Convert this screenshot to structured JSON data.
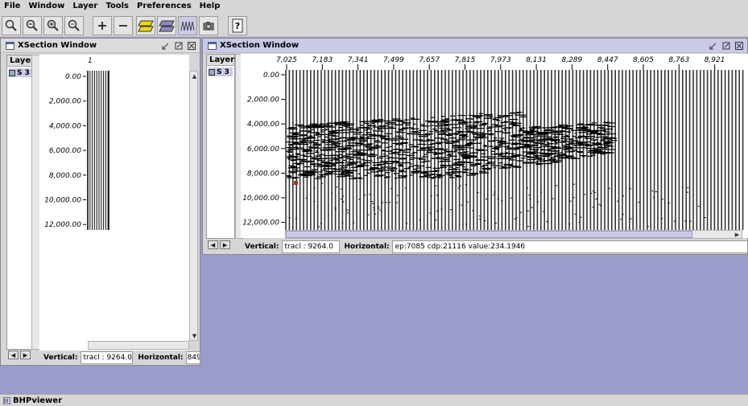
{
  "menubar": [
    "File",
    "Window",
    "Layer",
    "Tools",
    "Preferences",
    "Help"
  ],
  "toolbar": {
    "buttons": [
      "zoom-reset-icon",
      "zoom-out-icon",
      "zoom-in-icon",
      "zoom-out-small-icon",
      "add-icon",
      "remove-icon",
      "yellow-layer-icon",
      "gray-layer-icon",
      "wiggle-icon",
      "camera-icon",
      "help-icon"
    ]
  },
  "left_window": {
    "title": "XSection Window",
    "layers_header": "Layers",
    "layer_item": "S 3",
    "top_label": "1",
    "depth_ticks": [
      "0.00",
      "2,000.00",
      "4,000.00",
      "6,000.00",
      "8,000.00",
      "10,000.00",
      "12,000.00"
    ],
    "vertical_label": "Vertical:",
    "vertical_value": "tracl : 9264.0",
    "horizontal_label": "Horizontal:",
    "horizontal_value": "849"
  },
  "right_window": {
    "title": "XSection Window",
    "layers_header": "Layers",
    "layer_item": "S 3",
    "x_ticks": [
      "7,025",
      "7,183",
      "7,341",
      "7,499",
      "7,657",
      "7,815",
      "7,973",
      "8,131",
      "8,289",
      "8,447",
      "8,605",
      "8,763",
      "8,921"
    ],
    "depth_ticks": [
      "0.00",
      "2,000.00",
      "4,000.00",
      "6,000.00",
      "8,000.00",
      "10,000.00",
      "12,000.00"
    ],
    "vertical_label": "Vertical:",
    "vertical_value": "tracl : 9264.0",
    "horizontal_label": "Horizontal:",
    "horizontal_value": "ep:7085 cdp:21116 value:234.1946"
  },
  "taskbar": {
    "label": "BHPviewer"
  },
  "colors": {
    "desktop": "#9a9ccc",
    "chrome": "#d6d6d6",
    "active_title": "#c8cae8"
  }
}
